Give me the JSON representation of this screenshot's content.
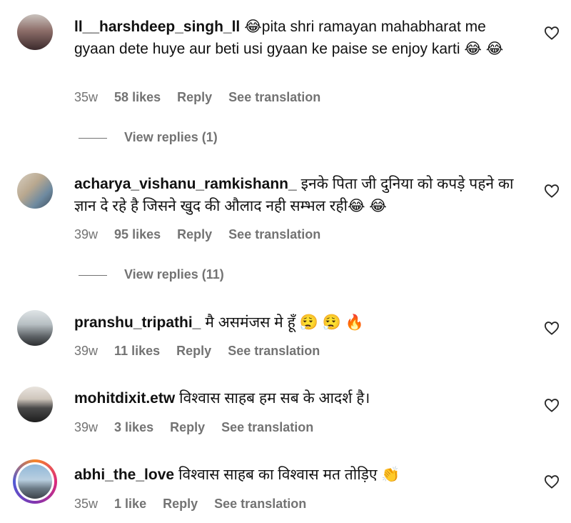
{
  "comments": [
    {
      "username": "ll__harshdeep_singh_ll",
      "text": "😂pita shri ramayan mahabharat me gyaan dete huye aur beti usi gyaan ke paise se enjoy karti 😂 😂",
      "time": "35w",
      "likes": "58 likes",
      "reply": "Reply",
      "translate": "See translation",
      "view_replies": "View replies (1)"
    },
    {
      "username": "acharya_vishanu_ramkishann_",
      "text": "इनके पिता जी दुनिया को कपड़े पहने का ज्ञान दे रहे है जिसने खुद की औलाद नही सम्भल रही😂 😂",
      "time": "39w",
      "likes": "95 likes",
      "reply": "Reply",
      "translate": "See translation",
      "view_replies": "View replies (11)"
    },
    {
      "username": "pranshu_tripathi_",
      "text": "मै असमंजस मे हूँ 😮‍💨 😮‍💨 🔥",
      "time": "39w",
      "likes": "11 likes",
      "reply": "Reply",
      "translate": "See translation"
    },
    {
      "username": "mohitdixit.etw",
      "text": "विश्वास साहब हम सब के आदर्श है।",
      "time": "39w",
      "likes": "3 likes",
      "reply": "Reply",
      "translate": "See translation"
    },
    {
      "username": "abhi_the_love",
      "text": "विश्वास साहब का विश्वास मत तोड़िए 👏",
      "time": "35w",
      "likes": "1 like",
      "reply": "Reply",
      "translate": "See translation"
    }
  ],
  "colors": {
    "muted": "#737373",
    "text": "#111111",
    "heart_stroke": "#262626"
  },
  "icons": {
    "like": "heart-outline-icon"
  }
}
